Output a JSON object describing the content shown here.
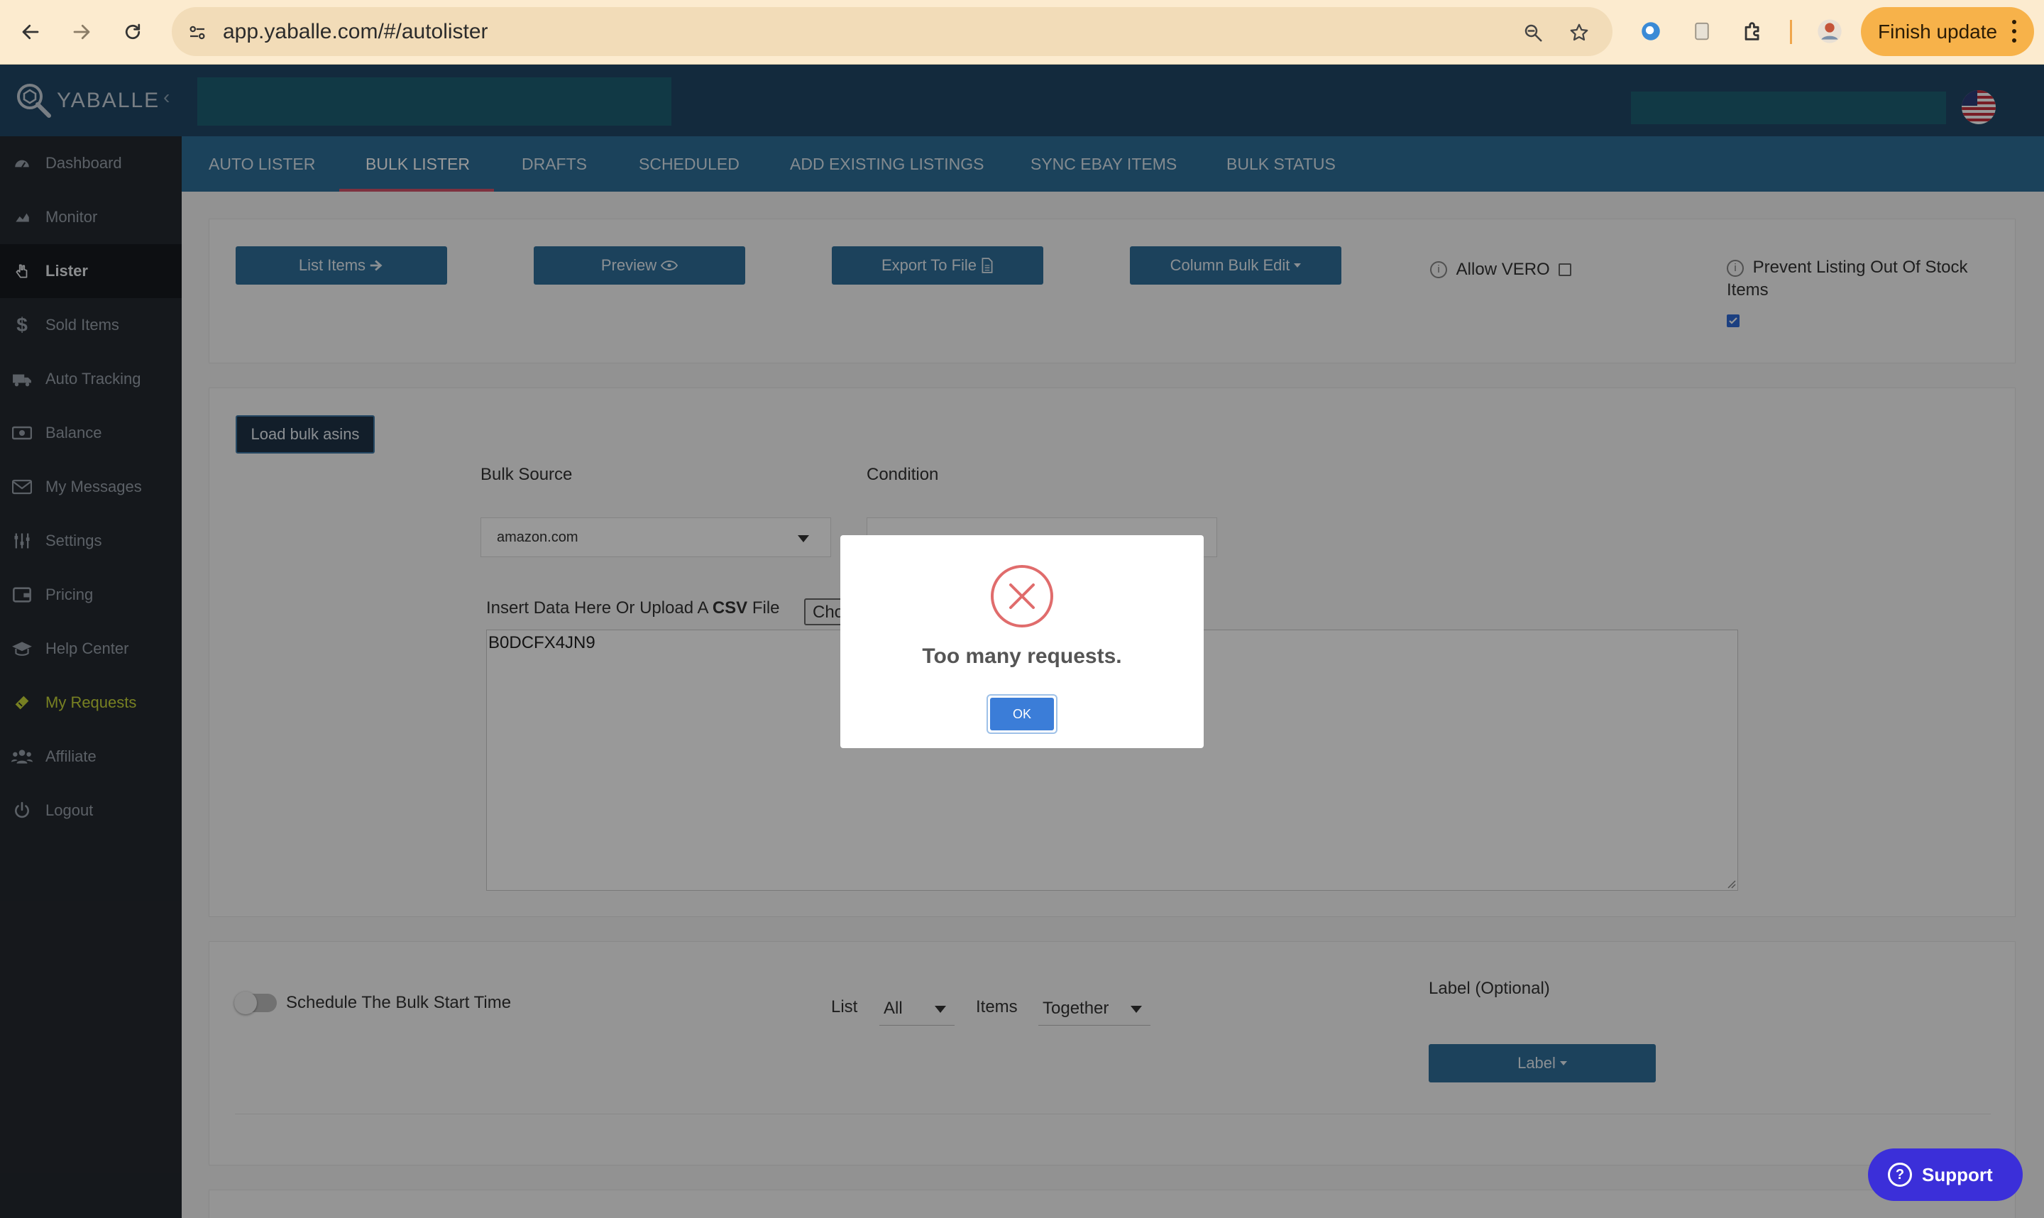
{
  "browser": {
    "url": "app.yaballe.com/#/autolister",
    "finish_update_label": "Finish update"
  },
  "app": {
    "logo_text": "YABALLE",
    "collapse_glyph": "‹"
  },
  "sidebar": {
    "items": [
      {
        "label": "Dashboard",
        "icon": "dashboard-icon"
      },
      {
        "label": "Monitor",
        "icon": "chart-icon"
      },
      {
        "label": "Lister",
        "icon": "hand-pointer-icon"
      },
      {
        "label": "Sold Items",
        "icon": "dollar-icon"
      },
      {
        "label": "Auto Tracking",
        "icon": "truck-icon"
      },
      {
        "label": "Balance",
        "icon": "money-icon"
      },
      {
        "label": "My Messages",
        "icon": "envelope-icon"
      },
      {
        "label": "Settings",
        "icon": "sliders-icon"
      },
      {
        "label": "Pricing",
        "icon": "wallet-icon"
      },
      {
        "label": "Help Center",
        "icon": "graduation-cap-icon"
      },
      {
        "label": "My Requests",
        "icon": "ticket-icon"
      },
      {
        "label": "Affiliate",
        "icon": "users-icon"
      },
      {
        "label": "Logout",
        "icon": "power-icon"
      }
    ],
    "active_index": 2,
    "highlight_index": 10
  },
  "tabs": [
    {
      "label": "AUTO LISTER"
    },
    {
      "label": "BULK LISTER"
    },
    {
      "label": "DRAFTS"
    },
    {
      "label": "SCHEDULED"
    },
    {
      "label": "ADD EXISTING LISTINGS"
    },
    {
      "label": "SYNC EBAY ITEMS"
    },
    {
      "label": "BULK STATUS"
    }
  ],
  "toolbar": {
    "list_items": "List Items",
    "preview": "Preview",
    "export": "Export To File",
    "column_bulk_edit": "Column Bulk Edit",
    "allow_vero": "Allow VERO",
    "prevent_listing": "Prevent Listing Out Of Stock Items"
  },
  "bulk": {
    "load_button": "Load bulk asins",
    "source_label": "Bulk Source",
    "source_value": "amazon.com",
    "condition_label": "Condition",
    "insert_label_prefix": "Insert Data Here Or Upload A ",
    "insert_label_bold": "CSV",
    "insert_label_suffix": " File",
    "choose_file_partial": "Cho",
    "textarea_value": "B0DCFX4JN9"
  },
  "schedule": {
    "toggle_label": "Schedule The Bulk Start Time",
    "list_label": "List",
    "list_value": "All",
    "items_label": "Items",
    "items_value": "Together",
    "label_optional": "Label (Optional)",
    "label_button": "Label"
  },
  "modal": {
    "title": "Too many requests.",
    "ok": "OK"
  },
  "support": {
    "label": "Support"
  },
  "colors": {
    "header": "#214766",
    "tabbar": "#2e6f98",
    "sidebar": "#24282f",
    "button": "#2f6f99",
    "error": "#e06c6c",
    "support": "#3b2fd9"
  }
}
